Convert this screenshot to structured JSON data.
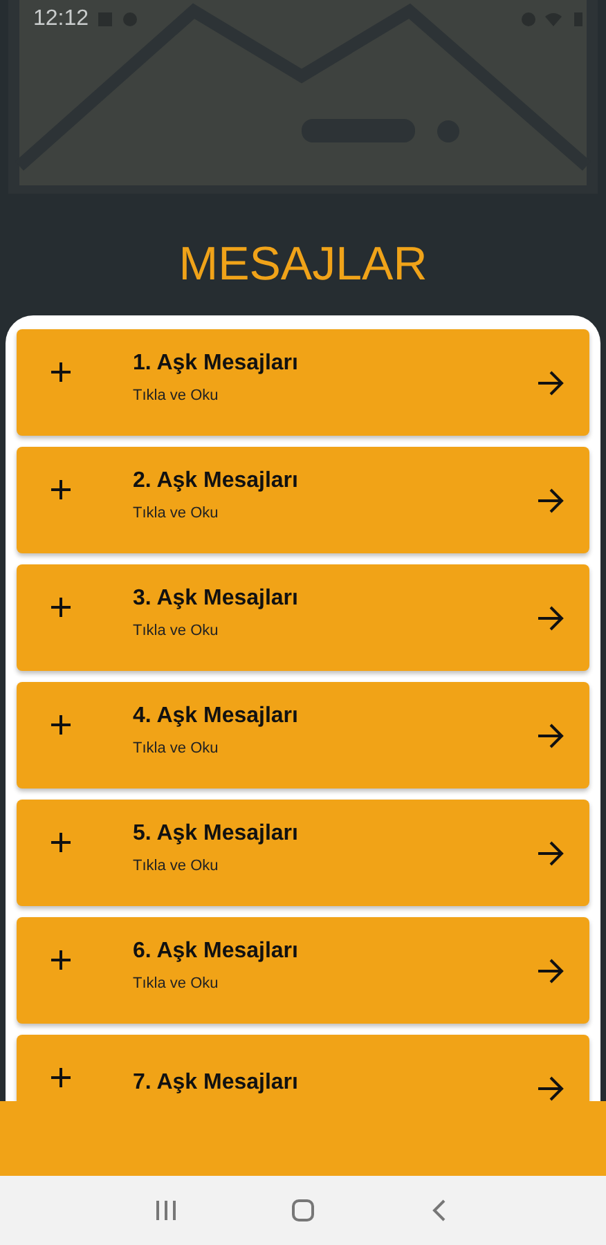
{
  "status_bar": {
    "time": "12:12"
  },
  "title": "MESAJLAR",
  "items": [
    {
      "title": "1. Aşk Mesajları",
      "subtitle": "Tıkla ve Oku"
    },
    {
      "title": "2. Aşk Mesajları",
      "subtitle": "Tıkla ve Oku"
    },
    {
      "title": "3. Aşk Mesajları",
      "subtitle": "Tıkla ve Oku"
    },
    {
      "title": "4. Aşk Mesajları",
      "subtitle": "Tıkla ve Oku"
    },
    {
      "title": "5. Aşk Mesajları",
      "subtitle": "Tıkla ve Oku"
    },
    {
      "title": "6. Aşk Mesajları",
      "subtitle": "Tıkla ve Oku"
    },
    {
      "title": "7. Aşk Mesajları"
    }
  ]
}
